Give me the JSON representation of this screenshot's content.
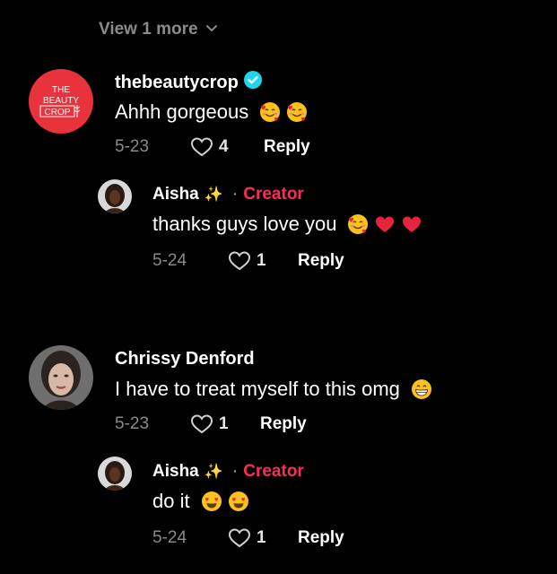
{
  "view_more": {
    "label": "View 1 more"
  },
  "comments": [
    {
      "username": "thebeautycrop",
      "verified": true,
      "avatar_text": [
        "THE",
        "BEAUTY",
        "CROP"
      ],
      "text": "Ahhh gorgeous",
      "emojis": [
        "smiling-face-with-hearts",
        "smiling-face-with-hearts"
      ],
      "date": "5-23",
      "likes": "4",
      "reply_label": "Reply",
      "reply": {
        "username": "Aisha",
        "separator": "·",
        "creator_label": "Creator",
        "text": "thanks guys love you",
        "emojis": [
          "smiling-face-with-hearts",
          "red-heart",
          "red-heart"
        ],
        "date": "5-24",
        "likes": "1",
        "reply_label": "Reply"
      }
    },
    {
      "username": "Chrissy Denford",
      "verified": false,
      "text": "I have to treat myself to this omg",
      "emojis": [
        "grinning-face"
      ],
      "date": "5-23",
      "likes": "1",
      "reply_label": "Reply",
      "reply": {
        "username": "Aisha",
        "separator": "·",
        "creator_label": "Creator",
        "text": "do it",
        "emojis": [
          "heart-eyes-face",
          "heart-eyes-face"
        ],
        "date": "5-24",
        "likes": "1",
        "reply_label": "Reply"
      }
    }
  ],
  "colors": {
    "background": "#000000",
    "creator": "#fe2c55",
    "muted": "#8a8a8e",
    "brand_red": "#e8333c",
    "verified": "#20d5ec"
  }
}
